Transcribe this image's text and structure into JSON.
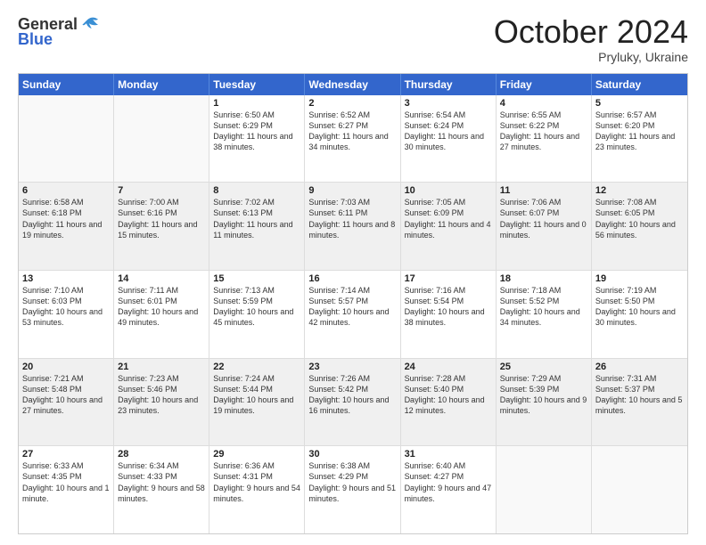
{
  "header": {
    "logo_general": "General",
    "logo_blue": "Blue",
    "month": "October 2024",
    "location": "Pryluky, Ukraine"
  },
  "days_of_week": [
    "Sunday",
    "Monday",
    "Tuesday",
    "Wednesday",
    "Thursday",
    "Friday",
    "Saturday"
  ],
  "weeks": [
    [
      {
        "day": "",
        "info": ""
      },
      {
        "day": "",
        "info": ""
      },
      {
        "day": "1",
        "info": "Sunrise: 6:50 AM\nSunset: 6:29 PM\nDaylight: 11 hours and 38 minutes."
      },
      {
        "day": "2",
        "info": "Sunrise: 6:52 AM\nSunset: 6:27 PM\nDaylight: 11 hours and 34 minutes."
      },
      {
        "day": "3",
        "info": "Sunrise: 6:54 AM\nSunset: 6:24 PM\nDaylight: 11 hours and 30 minutes."
      },
      {
        "day": "4",
        "info": "Sunrise: 6:55 AM\nSunset: 6:22 PM\nDaylight: 11 hours and 27 minutes."
      },
      {
        "day": "5",
        "info": "Sunrise: 6:57 AM\nSunset: 6:20 PM\nDaylight: 11 hours and 23 minutes."
      }
    ],
    [
      {
        "day": "6",
        "info": "Sunrise: 6:58 AM\nSunset: 6:18 PM\nDaylight: 11 hours and 19 minutes."
      },
      {
        "day": "7",
        "info": "Sunrise: 7:00 AM\nSunset: 6:16 PM\nDaylight: 11 hours and 15 minutes."
      },
      {
        "day": "8",
        "info": "Sunrise: 7:02 AM\nSunset: 6:13 PM\nDaylight: 11 hours and 11 minutes."
      },
      {
        "day": "9",
        "info": "Sunrise: 7:03 AM\nSunset: 6:11 PM\nDaylight: 11 hours and 8 minutes."
      },
      {
        "day": "10",
        "info": "Sunrise: 7:05 AM\nSunset: 6:09 PM\nDaylight: 11 hours and 4 minutes."
      },
      {
        "day": "11",
        "info": "Sunrise: 7:06 AM\nSunset: 6:07 PM\nDaylight: 11 hours and 0 minutes."
      },
      {
        "day": "12",
        "info": "Sunrise: 7:08 AM\nSunset: 6:05 PM\nDaylight: 10 hours and 56 minutes."
      }
    ],
    [
      {
        "day": "13",
        "info": "Sunrise: 7:10 AM\nSunset: 6:03 PM\nDaylight: 10 hours and 53 minutes."
      },
      {
        "day": "14",
        "info": "Sunrise: 7:11 AM\nSunset: 6:01 PM\nDaylight: 10 hours and 49 minutes."
      },
      {
        "day": "15",
        "info": "Sunrise: 7:13 AM\nSunset: 5:59 PM\nDaylight: 10 hours and 45 minutes."
      },
      {
        "day": "16",
        "info": "Sunrise: 7:14 AM\nSunset: 5:57 PM\nDaylight: 10 hours and 42 minutes."
      },
      {
        "day": "17",
        "info": "Sunrise: 7:16 AM\nSunset: 5:54 PM\nDaylight: 10 hours and 38 minutes."
      },
      {
        "day": "18",
        "info": "Sunrise: 7:18 AM\nSunset: 5:52 PM\nDaylight: 10 hours and 34 minutes."
      },
      {
        "day": "19",
        "info": "Sunrise: 7:19 AM\nSunset: 5:50 PM\nDaylight: 10 hours and 30 minutes."
      }
    ],
    [
      {
        "day": "20",
        "info": "Sunrise: 7:21 AM\nSunset: 5:48 PM\nDaylight: 10 hours and 27 minutes."
      },
      {
        "day": "21",
        "info": "Sunrise: 7:23 AM\nSunset: 5:46 PM\nDaylight: 10 hours and 23 minutes."
      },
      {
        "day": "22",
        "info": "Sunrise: 7:24 AM\nSunset: 5:44 PM\nDaylight: 10 hours and 19 minutes."
      },
      {
        "day": "23",
        "info": "Sunrise: 7:26 AM\nSunset: 5:42 PM\nDaylight: 10 hours and 16 minutes."
      },
      {
        "day": "24",
        "info": "Sunrise: 7:28 AM\nSunset: 5:40 PM\nDaylight: 10 hours and 12 minutes."
      },
      {
        "day": "25",
        "info": "Sunrise: 7:29 AM\nSunset: 5:39 PM\nDaylight: 10 hours and 9 minutes."
      },
      {
        "day": "26",
        "info": "Sunrise: 7:31 AM\nSunset: 5:37 PM\nDaylight: 10 hours and 5 minutes."
      }
    ],
    [
      {
        "day": "27",
        "info": "Sunrise: 6:33 AM\nSunset: 4:35 PM\nDaylight: 10 hours and 1 minute."
      },
      {
        "day": "28",
        "info": "Sunrise: 6:34 AM\nSunset: 4:33 PM\nDaylight: 9 hours and 58 minutes."
      },
      {
        "day": "29",
        "info": "Sunrise: 6:36 AM\nSunset: 4:31 PM\nDaylight: 9 hours and 54 minutes."
      },
      {
        "day": "30",
        "info": "Sunrise: 6:38 AM\nSunset: 4:29 PM\nDaylight: 9 hours and 51 minutes."
      },
      {
        "day": "31",
        "info": "Sunrise: 6:40 AM\nSunset: 4:27 PM\nDaylight: 9 hours and 47 minutes."
      },
      {
        "day": "",
        "info": ""
      },
      {
        "day": "",
        "info": ""
      }
    ]
  ]
}
